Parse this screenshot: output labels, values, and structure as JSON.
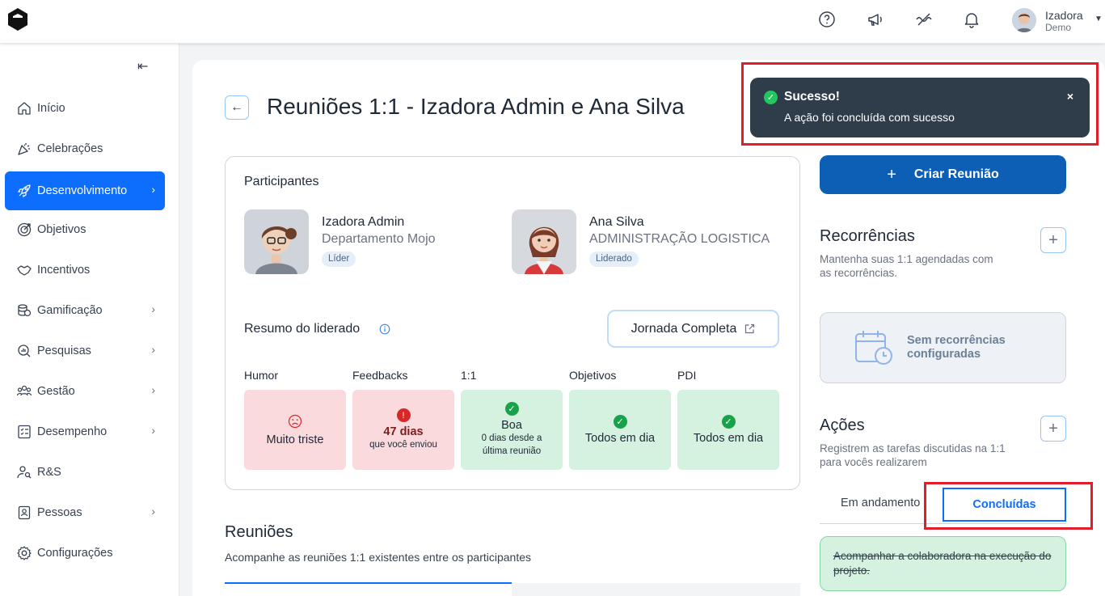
{
  "header": {
    "user_name": "Izadora",
    "user_role": "Demo"
  },
  "sidebar": {
    "items": [
      {
        "label": "Início"
      },
      {
        "label": "Celebrações"
      },
      {
        "label": "Desenvolvimento"
      },
      {
        "label": "Objetivos"
      },
      {
        "label": "Incentivos"
      },
      {
        "label": "Gamificação"
      },
      {
        "label": "Pesquisas"
      },
      {
        "label": "Gestão"
      },
      {
        "label": "Desempenho"
      },
      {
        "label": "R&S"
      },
      {
        "label": "Pessoas"
      },
      {
        "label": "Configurações"
      }
    ]
  },
  "page": {
    "title": "Reuniões 1:1 - Izadora Admin e Ana Silva"
  },
  "participants": {
    "heading": "Participantes",
    "leader": {
      "name": "Izadora Admin",
      "dept": "Departamento Mojo",
      "badge": "Líder"
    },
    "led": {
      "name": "Ana Silva",
      "dept": "ADMINISTRAÇÃO LOGISTICA",
      "badge": "Liderado"
    }
  },
  "summary": {
    "heading": "Resumo do liderado",
    "jornada_label": "Jornada Completa",
    "columns": [
      "Humor",
      "Feedbacks",
      "1:1",
      "Objetivos",
      "PDI"
    ],
    "tiles": {
      "humor": {
        "main": "Muito triste"
      },
      "feedbacks": {
        "main": "47 dias",
        "sub": "que você enviou"
      },
      "one_on_one": {
        "main": "Boa",
        "sub1": "0 dias desde a",
        "sub2": "última reunião"
      },
      "objetivos": {
        "main": "Todos em dia"
      },
      "pdi": {
        "main": "Todos em dia"
      }
    }
  },
  "meetings": {
    "title": "Reuniões",
    "subtitle": "Acompanhe as reuniões 1:1 existentes entre os participantes"
  },
  "right": {
    "create_label": "Criar Reunião",
    "recurrences_title": "Recorrências",
    "recurrences_sub": "Mantenha suas 1:1 agendadas com as recorrências.",
    "no_recurrences_1": "Sem recorrências",
    "no_recurrences_2": "configuradas",
    "actions_title": "Ações",
    "actions_sub": "Registrem as tarefas discutidas na 1:1 para vocês realizarem",
    "tab_in_progress": "Em andamento",
    "tab_done": "Concluídas",
    "done_task": "Acompanhar a colaboradora na execução do projeto."
  },
  "toast": {
    "title": "Sucesso!",
    "message": "A ação foi concluída com sucesso",
    "close": "×"
  },
  "colors": {
    "accent": "#0d6efd",
    "button": "#0d5eb5",
    "toast_bg": "#2f3d4b",
    "success": "#22c55e",
    "danger": "#dc2626",
    "highlight": "#e11d2a"
  }
}
